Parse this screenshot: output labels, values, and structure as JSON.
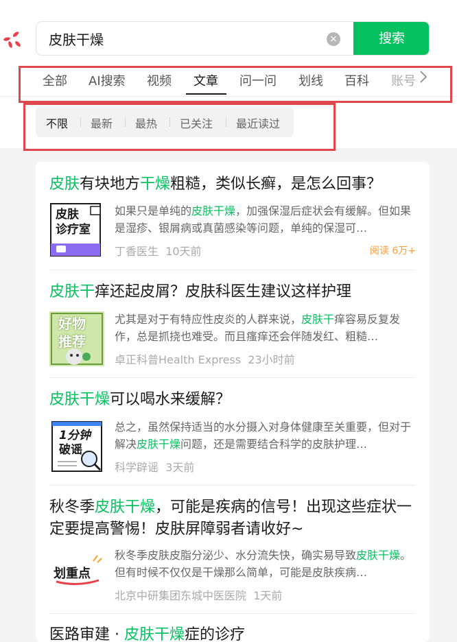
{
  "search": {
    "query": "皮肤干燥",
    "button_label": "搜索"
  },
  "tabs": [
    "全部",
    "AI搜索",
    "视频",
    "文章",
    "问一问",
    "划线",
    "百科",
    "账号"
  ],
  "filters": [
    "不限",
    "最新",
    "最热",
    "已关注",
    "最近读过"
  ],
  "colors": {
    "brand_green": "#07c160",
    "highlight_green": "#07c160",
    "annotation_red": "#e0474c",
    "read_orange": "#fa9d3b"
  },
  "results": [
    {
      "title": {
        "hl1": "皮肤",
        "t1": "有块地方",
        "hl2": "干燥",
        "t2": "粗糙，类似长癣，是怎么回事？"
      },
      "thumb": {
        "line1": "皮肤",
        "line2": "诊疗室"
      },
      "snippet": {
        "t1": "如果只是单纯的",
        "hl": "皮肤干燥",
        "t2": "，加强保湿后症状会有缓解。但如果是湿疹、银屑病或真菌感染等问题，单纯的保湿可…"
      },
      "source": "丁香医生",
      "time": "10天前",
      "reads": "阅读 6万+"
    },
    {
      "title": {
        "hl1": "皮肤干",
        "t1": "痒还起皮屑？皮肤科医生建议这样护理"
      },
      "thumb": {
        "line1": "好物",
        "line2": "推荐"
      },
      "snippet": {
        "t1": "尤其是对于有特应性皮炎的人群来说，",
        "hl": "皮肤干",
        "t2": "痒容易反复发作，总是抓挠也难受。而且瘙痒还会伴随发红、粗糙…"
      },
      "source": "卓正科普Health Express",
      "time": "23小时前"
    },
    {
      "title": {
        "hl1": "皮肤干燥",
        "t1": "可以喝水来缓解？"
      },
      "thumb": {
        "line1": "1分钟",
        "line2": "破谣"
      },
      "snippet": {
        "t1": "总之，虽然保持适当的水分摄入对身体健康至关重要，但对于解决",
        "hl": "皮肤干燥",
        "t2": "问题，还是需要结合科学的皮肤护理…"
      },
      "source": "科学辟谣",
      "time": "3天前"
    },
    {
      "title": {
        "t0": "秋冬季",
        "hl1": "皮肤干燥",
        "t1": "，可能是疾病的信号！出现这些症状一定要提高警惕！皮肤屏障弱者请收好~"
      },
      "thumb": {
        "line1": "划重点"
      },
      "snippet": {
        "t1": "秋冬季皮肤皮脂分泌少、水分流失快，确实易导致",
        "hl": "皮肤干燥",
        "t2": "。但有时候不仅仅是干燥那么简单，可能是皮肤疾病…"
      },
      "source": "北京中研集团东城中医医院",
      "time": "1天前"
    },
    {
      "title": {
        "t0": "医路审建 · ",
        "hl1": "皮肤干燥",
        "t1": "症的诊疗"
      }
    }
  ]
}
